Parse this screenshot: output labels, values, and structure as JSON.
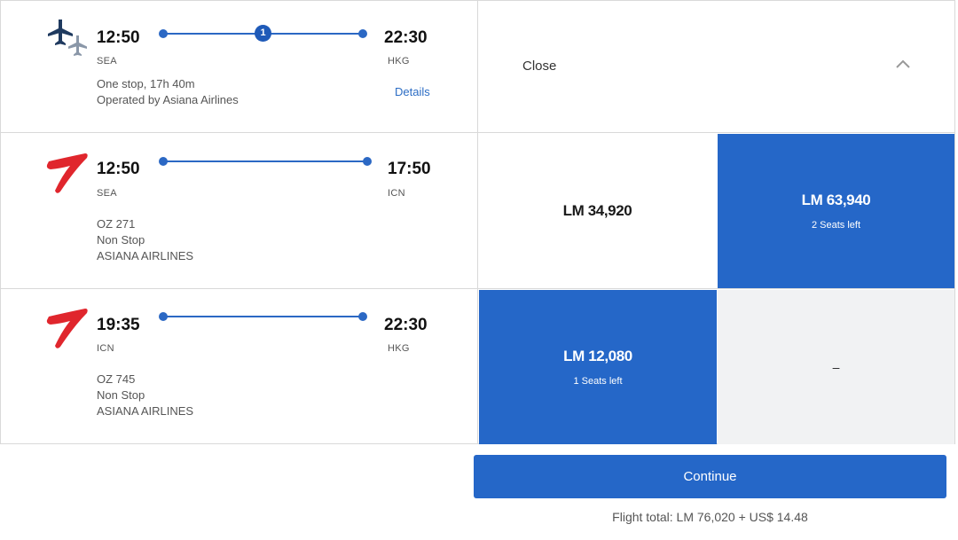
{
  "header_row": {
    "depart_time": "12:50",
    "depart_code": "SEA",
    "arrive_time": "22:30",
    "arrive_code": "HKG",
    "stops_badge": "1",
    "summary": "One stop, 17h 40m",
    "operated_by": "Operated by Asiana Airlines",
    "details_label": "Details",
    "close_label": "Close",
    "icon": "airplanes-icon",
    "collapse_icon": "chevron-up-icon"
  },
  "segments": [
    {
      "depart_time": "12:50",
      "depart_code": "SEA",
      "arrive_time": "17:50",
      "arrive_code": "ICN",
      "flight_number": "OZ 271",
      "stops": "Non Stop",
      "airline": "ASIANA AIRLINES",
      "logo": "asiana-logo-icon",
      "fares": [
        {
          "price": "LM 34,920",
          "seats": "",
          "selected": false
        },
        {
          "price": "LM 63,940",
          "seats": "2 Seats left",
          "selected": true
        }
      ]
    },
    {
      "depart_time": "19:35",
      "depart_code": "ICN",
      "arrive_time": "22:30",
      "arrive_code": "HKG",
      "flight_number": "OZ 745",
      "stops": "Non Stop",
      "airline": "ASIANA AIRLINES",
      "logo": "asiana-logo-icon",
      "fares": [
        {
          "price": "LM 12,080",
          "seats": "1 Seats left",
          "selected": true
        },
        {
          "price": "–",
          "seats": "",
          "selected": false
        }
      ]
    }
  ],
  "continue_label": "Continue",
  "flight_total": "Flight total: LM 76,020 + US$ 14.48",
  "colors": {
    "accent": "#2567c8",
    "route_line": "#2b68c4",
    "unavailable_bg": "#f1f2f3",
    "asiana_red": "#e0262d"
  }
}
